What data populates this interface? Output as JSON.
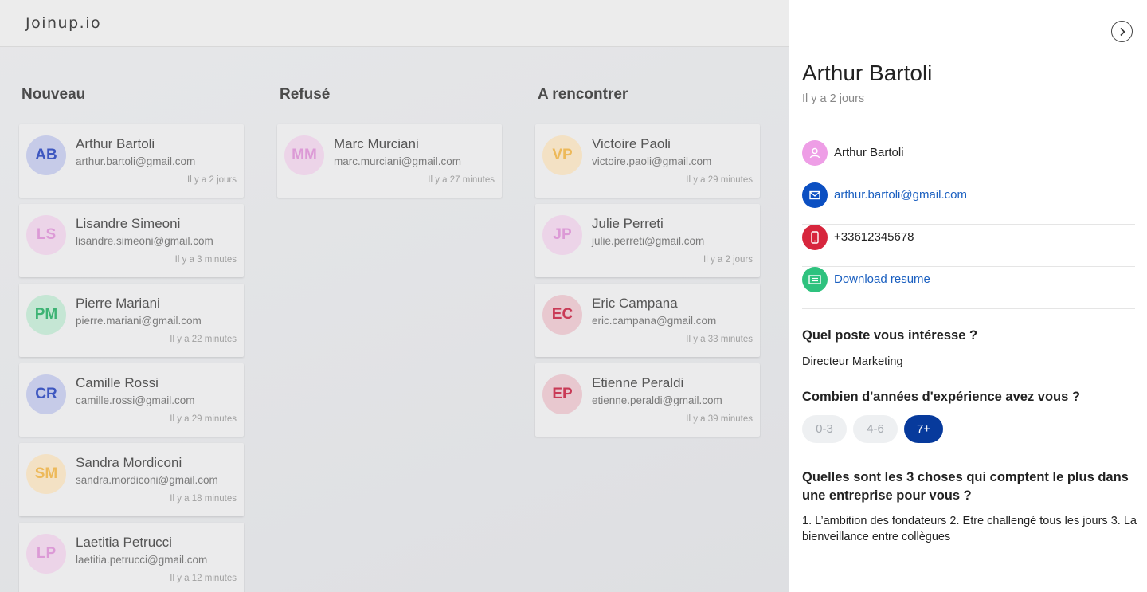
{
  "app": {
    "logo": "Joinup.io"
  },
  "columns": [
    {
      "title": "Nouveau",
      "cards": [
        {
          "initials": "AB",
          "name": "Arthur Bartoli",
          "email": "arthur.bartoli@gmail.com",
          "time": "Il y a 2 jours",
          "bg": "#c6cbe8",
          "fg": "#3e57c0"
        },
        {
          "initials": "LS",
          "name": "Lisandre Simeoni",
          "email": "lisandre.simeoni@gmail.com",
          "time": "Il y a 3 minutes",
          "bg": "#ecd4e8",
          "fg": "#dc9ad6"
        },
        {
          "initials": "PM",
          "name": "Pierre Mariani",
          "email": "pierre.mariani@gmail.com",
          "time": "Il y a 22 minutes",
          "bg": "#c5e6d4",
          "fg": "#3db374"
        },
        {
          "initials": "CR",
          "name": "Camille Rossi",
          "email": "camille.rossi@gmail.com",
          "time": "Il y a 29 minutes",
          "bg": "#c6cbe8",
          "fg": "#3e57c0"
        },
        {
          "initials": "SM",
          "name": "Sandra Mordiconi",
          "email": "sandra.mordiconi@gmail.com",
          "time": "Il y a 18 minutes",
          "bg": "#f3e1c4",
          "fg": "#edb95a"
        },
        {
          "initials": "LP",
          "name": "Laetitia Petrucci",
          "email": "laetitia.petrucci@gmail.com",
          "time": "Il y a 12 minutes",
          "bg": "#ecd4e8",
          "fg": "#dc9ad6"
        }
      ]
    },
    {
      "title": "Refusé",
      "cards": [
        {
          "initials": "MM",
          "name": "Marc Murciani",
          "email": "marc.murciani@gmail.com",
          "time": "Il y a 27 minutes",
          "bg": "#ecd4e8",
          "fg": "#dc9ad6"
        }
      ]
    },
    {
      "title": "A rencontrer",
      "cards": [
        {
          "initials": "VP",
          "name": "Victoire Paoli",
          "email": "victoire.paoli@gmail.com",
          "time": "Il y a 29 minutes",
          "bg": "#f3e1c4",
          "fg": "#edb95a"
        },
        {
          "initials": "JP",
          "name": "Julie Perreti",
          "email": "julie.perreti@gmail.com",
          "time": "Il y a 2 jours",
          "bg": "#ecd4e8",
          "fg": "#dc9ad6"
        },
        {
          "initials": "EC",
          "name": "Eric Campana",
          "email": "eric.campana@gmail.com",
          "time": "Il y a 33 minutes",
          "bg": "#e8c8cf",
          "fg": "#c93a56"
        },
        {
          "initials": "EP",
          "name": "Etienne Peraldi",
          "email": "etienne.peraldi@gmail.com",
          "time": "Il y a 39 minutes",
          "bg": "#e8c8cf",
          "fg": "#c93a56"
        }
      ]
    }
  ],
  "panel": {
    "close_icon": "chevron-right-circle-icon",
    "name": "Arthur Bartoli",
    "time": "Il y a 2 jours",
    "contact": {
      "name": "Arthur Bartoli",
      "email": "arthur.bartoli@gmail.com",
      "phone": "+33612345678",
      "resume": "Download resume"
    },
    "icon_colors": {
      "person": "#ee9ee6",
      "email": "#0b4fc2",
      "phone": "#d7263d",
      "resume": "#2ec27e"
    },
    "questions": [
      {
        "title": "Quel poste vous intéresse ?",
        "answer": "Directeur Marketing"
      },
      {
        "title": "Combien d'années d'expérience avez vous ?"
      },
      {
        "title": "Quelles sont les 3 choses qui comptent le plus dans une entreprise pour vous ?",
        "answer": "1. L’ambition des fondateurs 2. Etre challengé tous les jours 3. La bienveillance entre collègues"
      }
    ],
    "experience_options": [
      "0-3",
      "4-6",
      "7+"
    ],
    "experience_selected": "7+"
  }
}
